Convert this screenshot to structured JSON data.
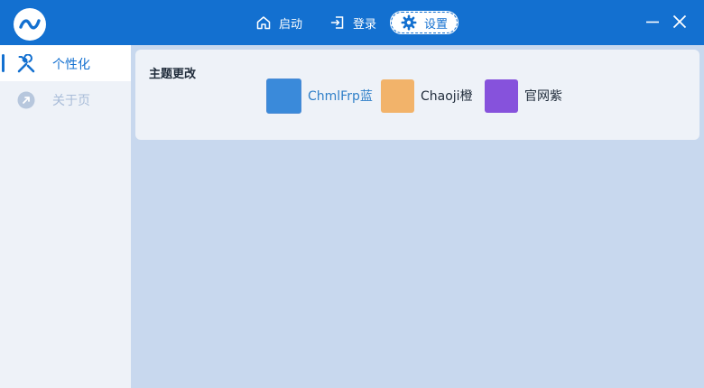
{
  "header": {
    "nav": [
      {
        "label": "启动",
        "icon": "home-icon"
      },
      {
        "label": "登录",
        "icon": "login-icon"
      },
      {
        "label": "设置",
        "icon": "gear-icon"
      }
    ],
    "active_nav": "设置"
  },
  "sidebar": {
    "items": [
      {
        "label": "个性化",
        "icon": "tools-icon",
        "active": true
      },
      {
        "label": "关于页",
        "icon": "info-circle-icon",
        "active": false
      }
    ]
  },
  "main": {
    "section_title": "主题更改",
    "themes": [
      {
        "name": "ChmlFrp蓝",
        "color": "#3a8ada",
        "selected": true
      },
      {
        "name": "Chaoji橙",
        "color": "#f2b36a",
        "selected": false
      },
      {
        "name": "官网紫",
        "color": "#8652dc",
        "selected": false
      }
    ]
  },
  "colors": {
    "accent": "#1370d0",
    "content_bg": "#c8d8ee",
    "sidebar_bg": "#eef2f8"
  }
}
